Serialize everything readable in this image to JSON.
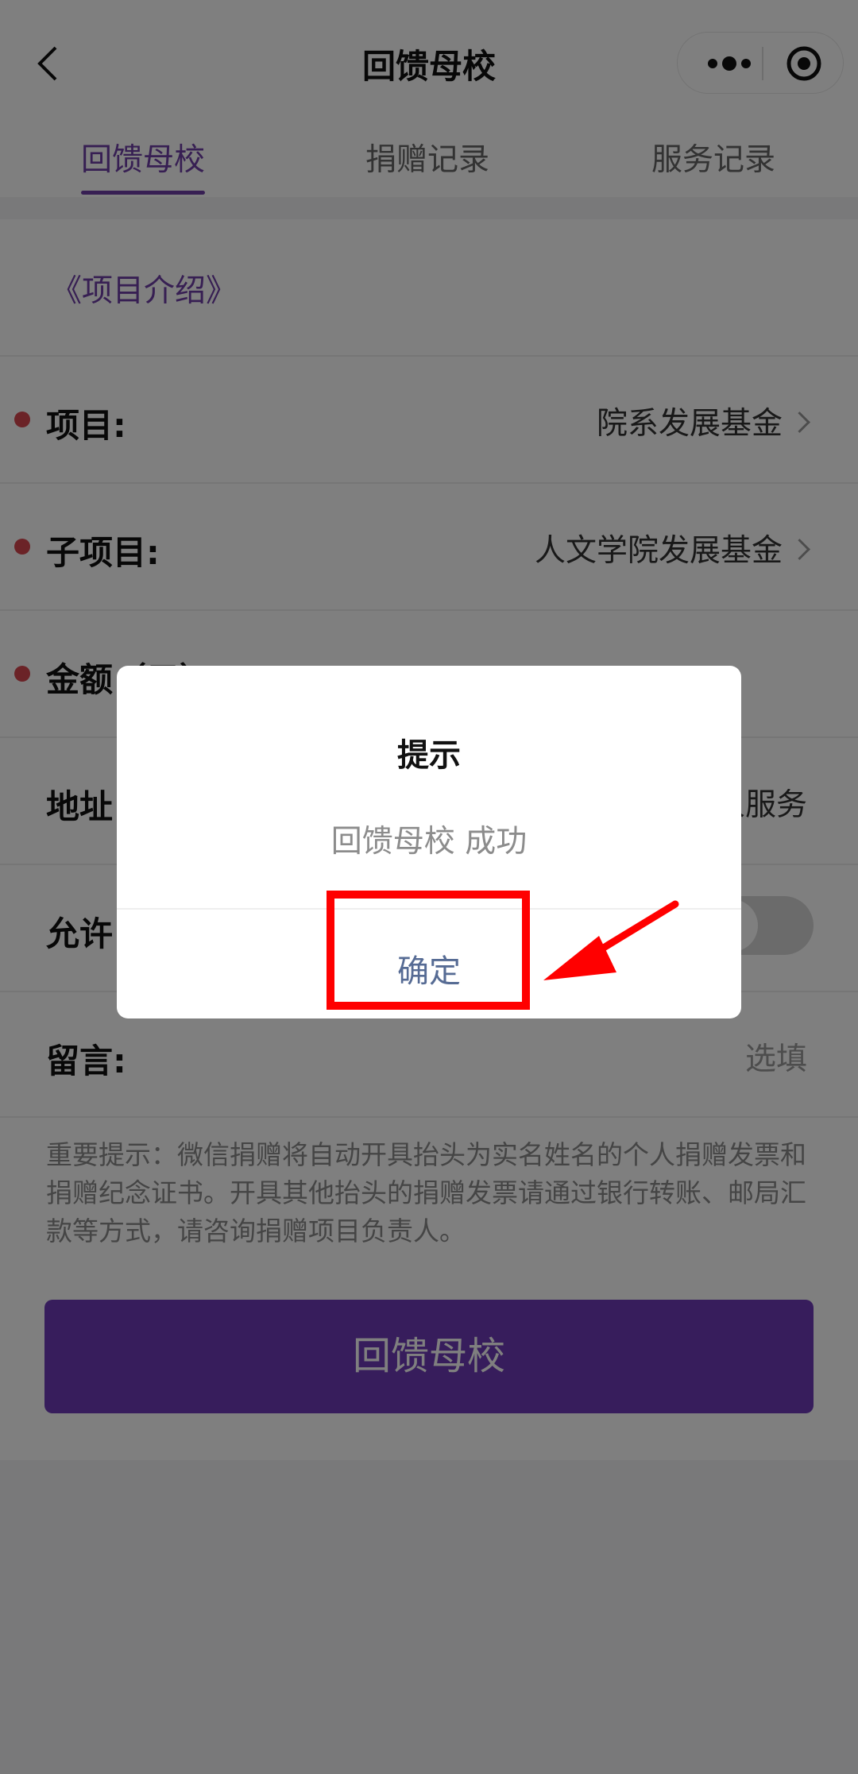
{
  "nav": {
    "title": "回馈母校"
  },
  "tabs": [
    {
      "label": "回馈母校",
      "active": true
    },
    {
      "label": "捐赠记录",
      "active": false
    },
    {
      "label": "服务记录",
      "active": false
    }
  ],
  "form": {
    "intro_link": "《项目介绍》",
    "project_label": "项目:",
    "project_value": "院系发展基金",
    "subproject_label": "子项目:",
    "subproject_value": "人文学院发展基金",
    "amount_label": "金额（元）",
    "address_label": "地址",
    "address_value": "人服务",
    "allow_label": "允许",
    "message_label": "留言:",
    "message_placeholder": "选填"
  },
  "notice": "重要提示：微信捐赠将自动开具抬头为实名姓名的个人捐赠发票和捐赠纪念证书。开具其他抬头的捐赠发票请通过银行转账、邮局汇款等方式，请咨询捐赠项目负责人。",
  "submit_label": "回馈母校",
  "dialog": {
    "title": "提示",
    "message": "回馈母校 成功",
    "ok_label": "确定"
  },
  "colors": {
    "accent": "#6f3fa7",
    "button": "#6e3ab8",
    "required_dot": "#d6464f",
    "highlight": "#ff0000"
  }
}
